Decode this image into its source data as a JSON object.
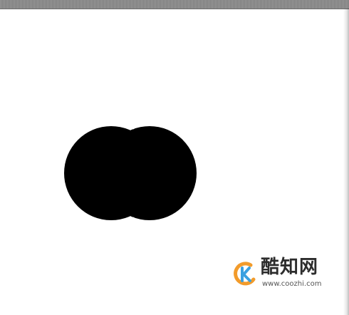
{
  "watermark": {
    "site_name": "酷知网",
    "url": "www.coozhi.com",
    "logo_icon": "coozhi-logo-icon",
    "logo_colors": {
      "orange": "#f29b2b",
      "blue": "#3aa0e0"
    }
  },
  "shape": {
    "fill": "#000000",
    "description_icon": "two-overlapping-circles"
  },
  "colors": {
    "background": "#ffffff",
    "top_strip": "#8a8a8a"
  }
}
